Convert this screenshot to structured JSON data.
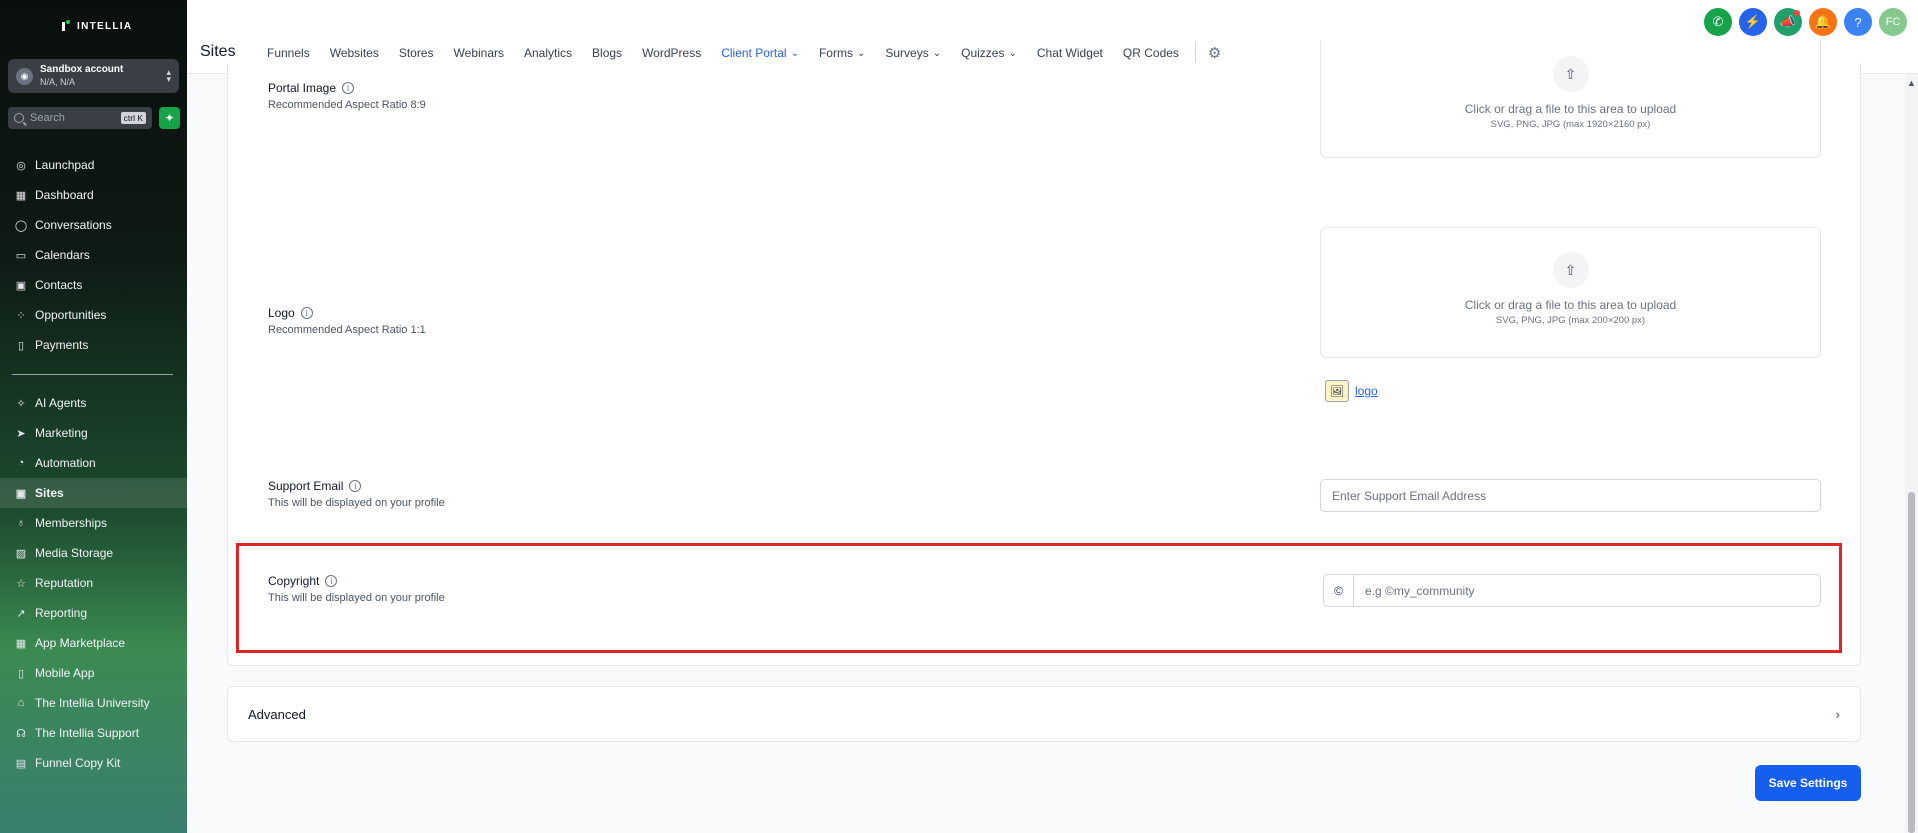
{
  "brand": {
    "name": "INTELLIA"
  },
  "account": {
    "name": "Sandbox account",
    "location": "N/A, N/A"
  },
  "search": {
    "placeholder": "Search",
    "shortcut": "ctrl K"
  },
  "sidebar": {
    "items": [
      {
        "label": "Launchpad",
        "icon": "rocket-icon",
        "glyph": "◎"
      },
      {
        "label": "Dashboard",
        "icon": "dashboard-icon",
        "glyph": "▦"
      },
      {
        "label": "Conversations",
        "icon": "chat-icon",
        "glyph": "◯"
      },
      {
        "label": "Calendars",
        "icon": "calendar-icon",
        "glyph": "▭"
      },
      {
        "label": "Contacts",
        "icon": "contacts-icon",
        "glyph": "▣"
      },
      {
        "label": "Opportunities",
        "icon": "opportunities-icon",
        "glyph": "⁘"
      },
      {
        "label": "Payments",
        "icon": "payments-icon",
        "glyph": "▯"
      }
    ],
    "items2": [
      {
        "label": "AI Agents",
        "icon": "ai-agents-icon",
        "glyph": "✧",
        "active": false
      },
      {
        "label": "Marketing",
        "icon": "marketing-icon",
        "glyph": "➤",
        "active": false
      },
      {
        "label": "Automation",
        "icon": "automation-icon",
        "glyph": "◔",
        "active": false
      },
      {
        "label": "Sites",
        "icon": "sites-icon",
        "glyph": "▣",
        "active": true
      },
      {
        "label": "Memberships",
        "icon": "memberships-icon",
        "glyph": "♁",
        "active": false
      },
      {
        "label": "Media Storage",
        "icon": "media-storage-icon",
        "glyph": "▨",
        "active": false
      },
      {
        "label": "Reputation",
        "icon": "reputation-icon",
        "glyph": "☆",
        "active": false
      },
      {
        "label": "Reporting",
        "icon": "reporting-icon",
        "glyph": "↗",
        "active": false
      },
      {
        "label": "App Marketplace",
        "icon": "app-marketplace-icon",
        "glyph": "▦",
        "active": false
      },
      {
        "label": "Mobile App",
        "icon": "mobile-app-icon",
        "glyph": "▯",
        "active": false
      },
      {
        "label": "The Intellia University",
        "icon": "university-icon",
        "glyph": "⌂",
        "active": false
      },
      {
        "label": "The Intellia Support",
        "icon": "support-icon",
        "glyph": "☊",
        "active": false
      },
      {
        "label": "Funnel Copy Kit",
        "icon": "document-icon",
        "glyph": "▤",
        "active": false
      }
    ]
  },
  "header": {
    "title": "Sites",
    "tabs": [
      {
        "label": "Funnels",
        "dropdown": false,
        "active": false
      },
      {
        "label": "Websites",
        "dropdown": false,
        "active": false
      },
      {
        "label": "Stores",
        "dropdown": false,
        "active": false
      },
      {
        "label": "Webinars",
        "dropdown": false,
        "active": false
      },
      {
        "label": "Analytics",
        "dropdown": false,
        "active": false
      },
      {
        "label": "Blogs",
        "dropdown": false,
        "active": false
      },
      {
        "label": "WordPress",
        "dropdown": false,
        "active": false
      },
      {
        "label": "Client Portal",
        "dropdown": true,
        "active": true
      },
      {
        "label": "Forms",
        "dropdown": true,
        "active": false
      },
      {
        "label": "Surveys",
        "dropdown": true,
        "active": false
      },
      {
        "label": "Quizzes",
        "dropdown": true,
        "active": false
      },
      {
        "label": "Chat Widget",
        "dropdown": false,
        "active": false
      },
      {
        "label": "QR Codes",
        "dropdown": false,
        "active": false
      }
    ],
    "top_icons": [
      {
        "name": "phone-icon",
        "glyph": "✆",
        "color": "#16a34a"
      },
      {
        "name": "quick-actions-icon",
        "glyph": "⚡",
        "color": "#2563eb"
      },
      {
        "name": "announcements-icon",
        "glyph": "📣",
        "color": "#22a06b",
        "dot": true
      },
      {
        "name": "bell-icon",
        "glyph": "🔔",
        "color": "#f97316"
      },
      {
        "name": "help-icon",
        "glyph": "?",
        "color": "#3b82f6"
      }
    ],
    "avatar": "FC",
    "avatar_color": "#86c98e"
  },
  "form": {
    "portal_image": {
      "label": "Portal Image",
      "sub": "Recommended Aspect Ratio 8:9",
      "upload_main": "Click or drag a file to this area to upload",
      "upload_sub": "SVG, PNG, JPG (max 1920×2160 px)"
    },
    "logo": {
      "label": "Logo",
      "sub": "Recommended Aspect Ratio 1:1",
      "upload_main": "Click or drag a file to this area to upload",
      "upload_sub": "SVG, PNG, JPG (max 200×200 px)",
      "file_name": "logo"
    },
    "support_email": {
      "label": "Support Email",
      "sub": "This will be displayed on your profile",
      "placeholder": "Enter Support Email Address"
    },
    "copyright": {
      "label": "Copyright",
      "sub": "This will be displayed on your profile",
      "prefix": "©",
      "placeholder": "e.g ©my_community"
    }
  },
  "advanced": {
    "label": "Advanced"
  },
  "save_button": "Save Settings",
  "colors": {
    "accent": "#155eef",
    "highlight": "#dc2626",
    "active_tab": "#2563eb"
  }
}
